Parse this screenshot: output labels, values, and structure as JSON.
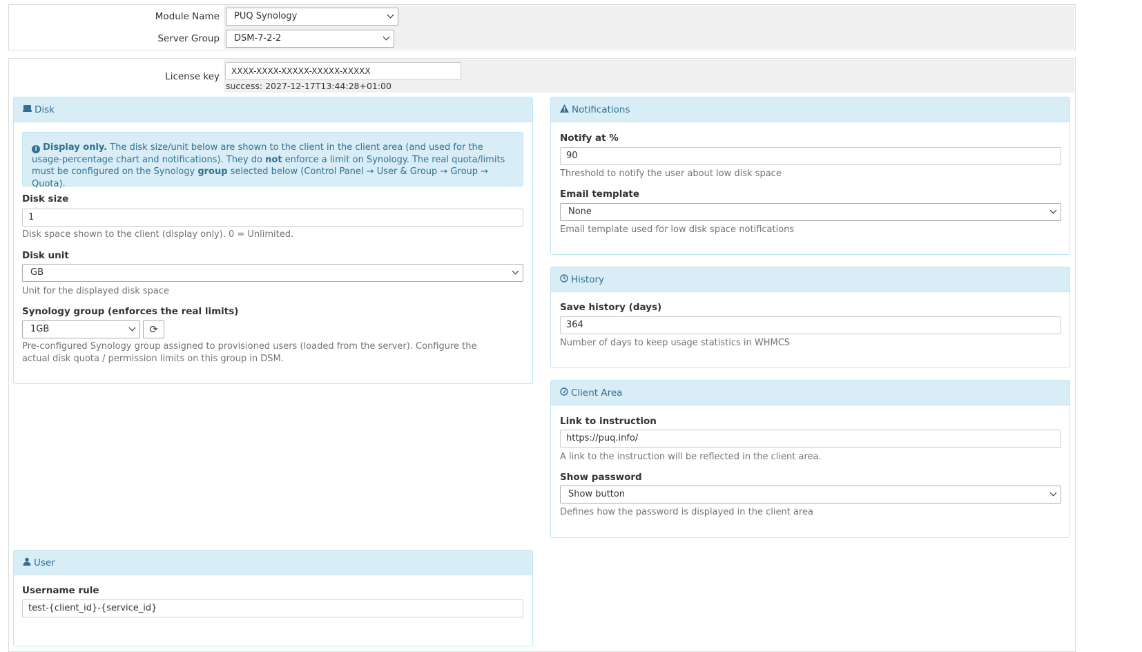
{
  "module": {
    "module_name_label": "Module Name",
    "module_name_value": "PUQ Synology",
    "server_group_label": "Server Group",
    "server_group_value": "DSM-7-2-2"
  },
  "license": {
    "label": "License key",
    "value": "XXXX-XXXX-XXXXX-XXXXX-XXXXX",
    "status": "success: 2027-12-17T13:44:28+01:00"
  },
  "disk": {
    "title": "Disk",
    "info_bold": "Display only.",
    "info_text_1": " The disk size/unit below are shown to the client in the client area (and used for the usage-percentage chart and notifications). They do ",
    "info_not": "not",
    "info_text_2": " enforce a limit on Synology. The real quota/limits must be configured on the Synology ",
    "info_group": "group",
    "info_text_3": " selected below (Control Panel → User & Group → Group → Quota).",
    "disk_size_label": "Disk size",
    "disk_size_value": "1",
    "disk_size_help": "Disk space shown to the client (display only). 0 = Unlimited.",
    "disk_unit_label": "Disk unit",
    "disk_unit_value": "GB",
    "disk_unit_help": "Unit for the displayed disk space",
    "group_label": "Synology group (enforces the real limits)",
    "group_value": "1GB",
    "group_help": "Pre-configured Synology group assigned to provisioned users (loaded from the server). Configure the actual disk quota / permission limits on this group in DSM."
  },
  "notifications": {
    "title": "Notifications",
    "notify_label": "Notify at %",
    "notify_value": "90",
    "notify_help": "Threshold to notify the user about low disk space",
    "template_label": "Email template",
    "template_value": "None",
    "template_help": "Email template used for low disk space notifications"
  },
  "history": {
    "title": "History",
    "save_label": "Save history (days)",
    "save_value": "364",
    "save_help": "Number of days to keep usage statistics in WHMCS"
  },
  "client_area": {
    "title": "Client Area",
    "link_label": "Link to instruction",
    "link_value": "https://puq.info/",
    "link_help": "A link to the instruction will be reflected in the client area.",
    "show_password_label": "Show password",
    "show_password_value": "Show button",
    "show_password_help": "Defines how the password is displayed in the client area"
  },
  "user": {
    "title": "User",
    "username_rule_label": "Username rule",
    "username_rule_value": "test-{client_id}-{service_id}"
  },
  "colors": {
    "panel_header_bg": "#d9edf7",
    "panel_header_text": "#31708f",
    "panel_border": "#bce8f1",
    "field_bg": "#f0f0f0"
  }
}
